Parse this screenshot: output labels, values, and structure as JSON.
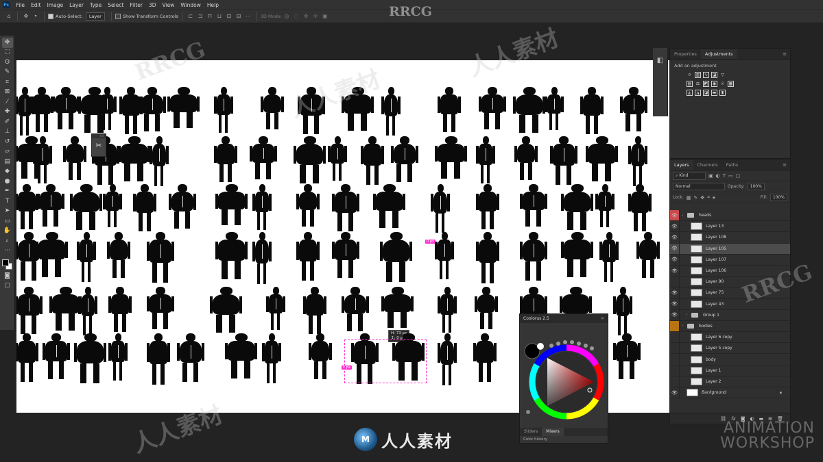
{
  "app": {
    "logo": "Ps",
    "menu": [
      "File",
      "Edit",
      "Image",
      "Layer",
      "Type",
      "Select",
      "Filter",
      "3D",
      "View",
      "Window",
      "Help"
    ]
  },
  "options": {
    "auto_select_label": "Auto-Select:",
    "auto_select_value": "Layer",
    "show_transform_label": "Show Transform Controls",
    "mode_3d_label": "3D Mode:"
  },
  "toolbar": {
    "tools": [
      "move-tool-icon",
      "marquee-tool-icon",
      "lasso-tool-icon",
      "quick-select-tool-icon",
      "crop-tool-icon",
      "frame-tool-icon",
      "eyedropper-tool-icon",
      "healing-brush-icon",
      "brush-tool-icon",
      "clone-stamp-icon",
      "history-brush-icon",
      "eraser-tool-icon",
      "gradient-tool-icon",
      "blur-tool-icon",
      "dodge-tool-icon",
      "pen-tool-icon",
      "type-tool-icon",
      "path-select-icon",
      "rectangle-tool-icon",
      "hand-tool-icon",
      "zoom-tool-icon",
      "more-tools-icon"
    ]
  },
  "canvas": {
    "tag_1": "0 px",
    "tag_2": "0 px",
    "measure_w": "H: 73 px",
    "measure_h": "↕: 0 px"
  },
  "adjustments": {
    "tab_properties": "Properties",
    "tab_adjustments": "Adjustments",
    "add_label": "Add an adjustment"
  },
  "layers": {
    "tab_layers": "Layers",
    "tab_channels": "Channels",
    "tab_paths": "Paths",
    "filter_kind": "Kind",
    "blend_mode": "Normal",
    "opacity_label": "Opacity:",
    "opacity_value": "100%",
    "lock_label": "Lock:",
    "fill_label": "Fill:",
    "fill_value": "100%",
    "items": [
      {
        "name": "heads",
        "type": "folder"
      },
      {
        "name": "Layer 13",
        "type": "layer"
      },
      {
        "name": "Layer 108",
        "type": "layer"
      },
      {
        "name": "Layer 105",
        "type": "layer"
      },
      {
        "name": "Layer 107",
        "type": "layer"
      },
      {
        "name": "Layer 106",
        "type": "layer"
      },
      {
        "name": "Layer 90",
        "type": "layer"
      },
      {
        "name": "Layer 75",
        "type": "layer"
      },
      {
        "name": "Layer 43",
        "type": "layer"
      },
      {
        "name": "Group 1",
        "type": "folder"
      },
      {
        "name": "bodies",
        "type": "folder"
      },
      {
        "name": "Layer 6 copy",
        "type": "layer"
      },
      {
        "name": "Layer 5 copy",
        "type": "layer"
      },
      {
        "name": "body",
        "type": "layer"
      },
      {
        "name": "Layer 1",
        "type": "layer"
      },
      {
        "name": "Layer 2",
        "type": "layer"
      },
      {
        "name": "Background",
        "type": "background"
      }
    ]
  },
  "coolorus": {
    "title": "Coolorus 2.5",
    "tab_sliders": "Sliders",
    "tab_mixers": "Mixers",
    "history_label": "Color history"
  },
  "branding": {
    "watermark": "RRCG",
    "watermark_cn": "人人素材",
    "bottom_logo_text": "人人素材",
    "bottom_logo_badge": "M",
    "aw_line1": "ANIMATION",
    "aw_line2": "WORKSHOP"
  }
}
